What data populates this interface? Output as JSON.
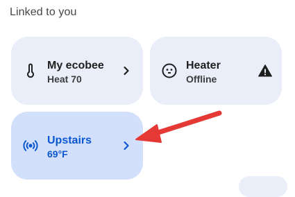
{
  "section": {
    "title": "Linked to you"
  },
  "tiles": [
    {
      "name": "My ecobee",
      "status": "Heat 70",
      "icon": "thermometer-icon",
      "trailing_icon": "chevron-right-icon"
    },
    {
      "name": "Heater",
      "status": "Offline",
      "icon": "outlet-icon",
      "trailing_icon": "warning-icon"
    },
    {
      "name": "Upstairs",
      "status": "69°F",
      "icon": "sensor-broadcast-icon",
      "trailing_icon": "chevron-right-icon"
    }
  ],
  "colors": {
    "tile_background": "#e9eef8",
    "active_tile_background": "#d3e0fb",
    "active_text": "#0b57d0",
    "annotation_arrow": "#e53935"
  }
}
